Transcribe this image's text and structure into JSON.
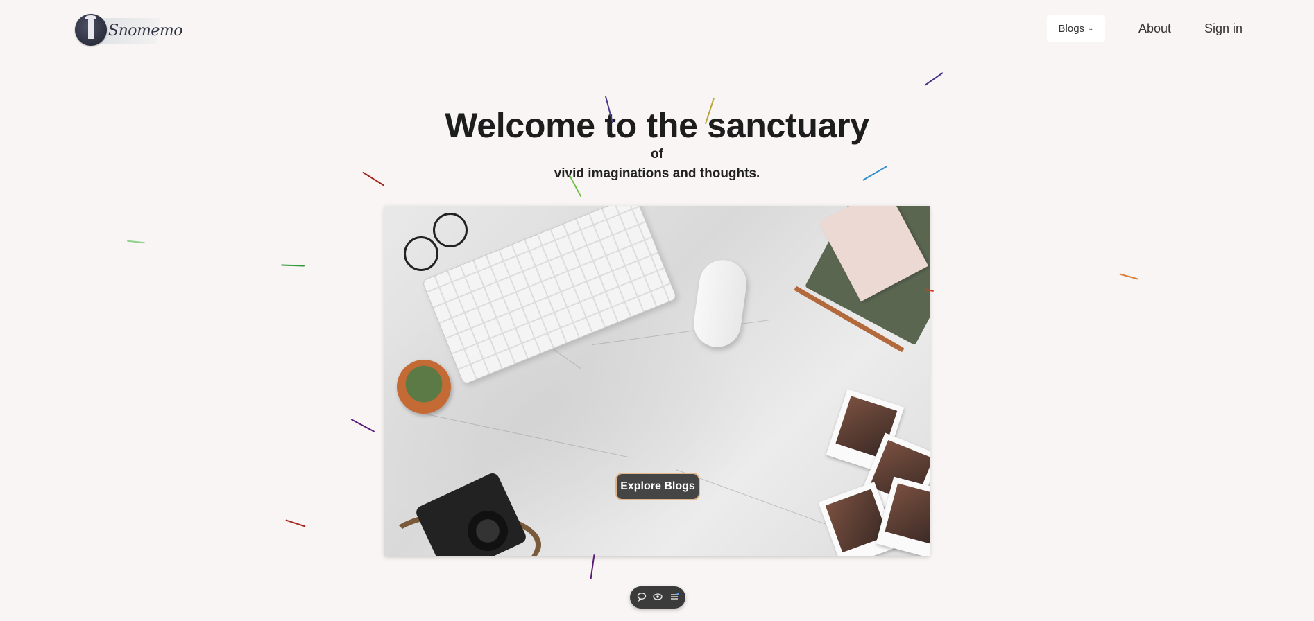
{
  "header": {
    "logo_text": "Snomemo",
    "nav": {
      "blogs_label": "Blogs",
      "about_label": "About",
      "signin_label": "Sign in"
    }
  },
  "hero": {
    "title": "Welcome to the sanctuary",
    "of": "of",
    "subtitle": "vivid imaginations and thoughts.",
    "cta_label": "Explore Blogs"
  },
  "float_bar": {
    "icons": [
      "chat-icon",
      "eye-icon",
      "list-icon"
    ]
  },
  "colors": {
    "background": "#f8f5f4",
    "button_bg": "#454545",
    "button_border": "#e2b489"
  }
}
